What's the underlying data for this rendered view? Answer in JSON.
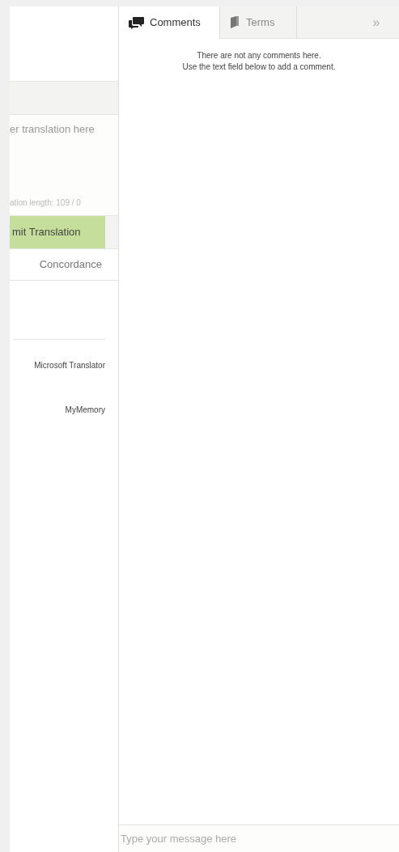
{
  "editor": {
    "translation_placeholder": "er translation here",
    "length_label": "ation length: 109 / 0",
    "submit_button": "mit Translation",
    "concordance_tab": "Concordance",
    "providers": [
      "Microsoft Translator",
      "MyMemory"
    ]
  },
  "side_panel": {
    "tabs": [
      {
        "label": "Comments",
        "kind": "comments",
        "selected": true
      },
      {
        "label": "Terms",
        "kind": "terms",
        "selected": false
      }
    ],
    "collapse": "»",
    "empty_message": [
      "There are not any comments here.",
      "Use the text field below to add a comment."
    ],
    "message_placeholder": "Type your message here"
  }
}
